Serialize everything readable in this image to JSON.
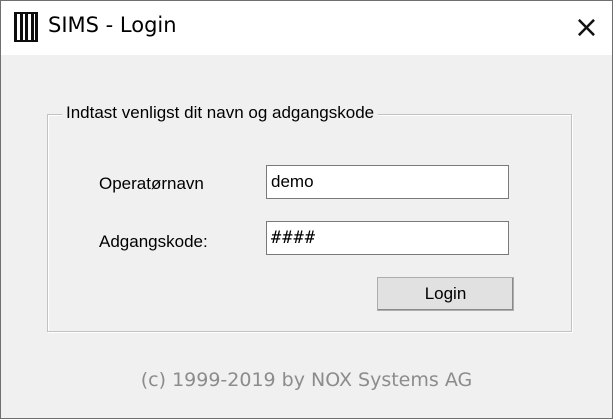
{
  "window": {
    "title": "SIMS - Login",
    "icon": "sims-barcode-icon",
    "close_label": "×"
  },
  "group": {
    "legend": "Indtast venligst dit navn og adgangskode"
  },
  "form": {
    "operator_label": "Operatørnavn",
    "operator_value": "demo",
    "password_label": "Adgangskode:",
    "password_value": "####",
    "login_label": "Login"
  },
  "footer": {
    "copyright": "(c) 1999-2019 by NOX Systems AG"
  },
  "colors": {
    "window_bg": "#f0f0f0",
    "titlebar_bg": "#ffffff",
    "footer_text": "#8c8c8c"
  }
}
